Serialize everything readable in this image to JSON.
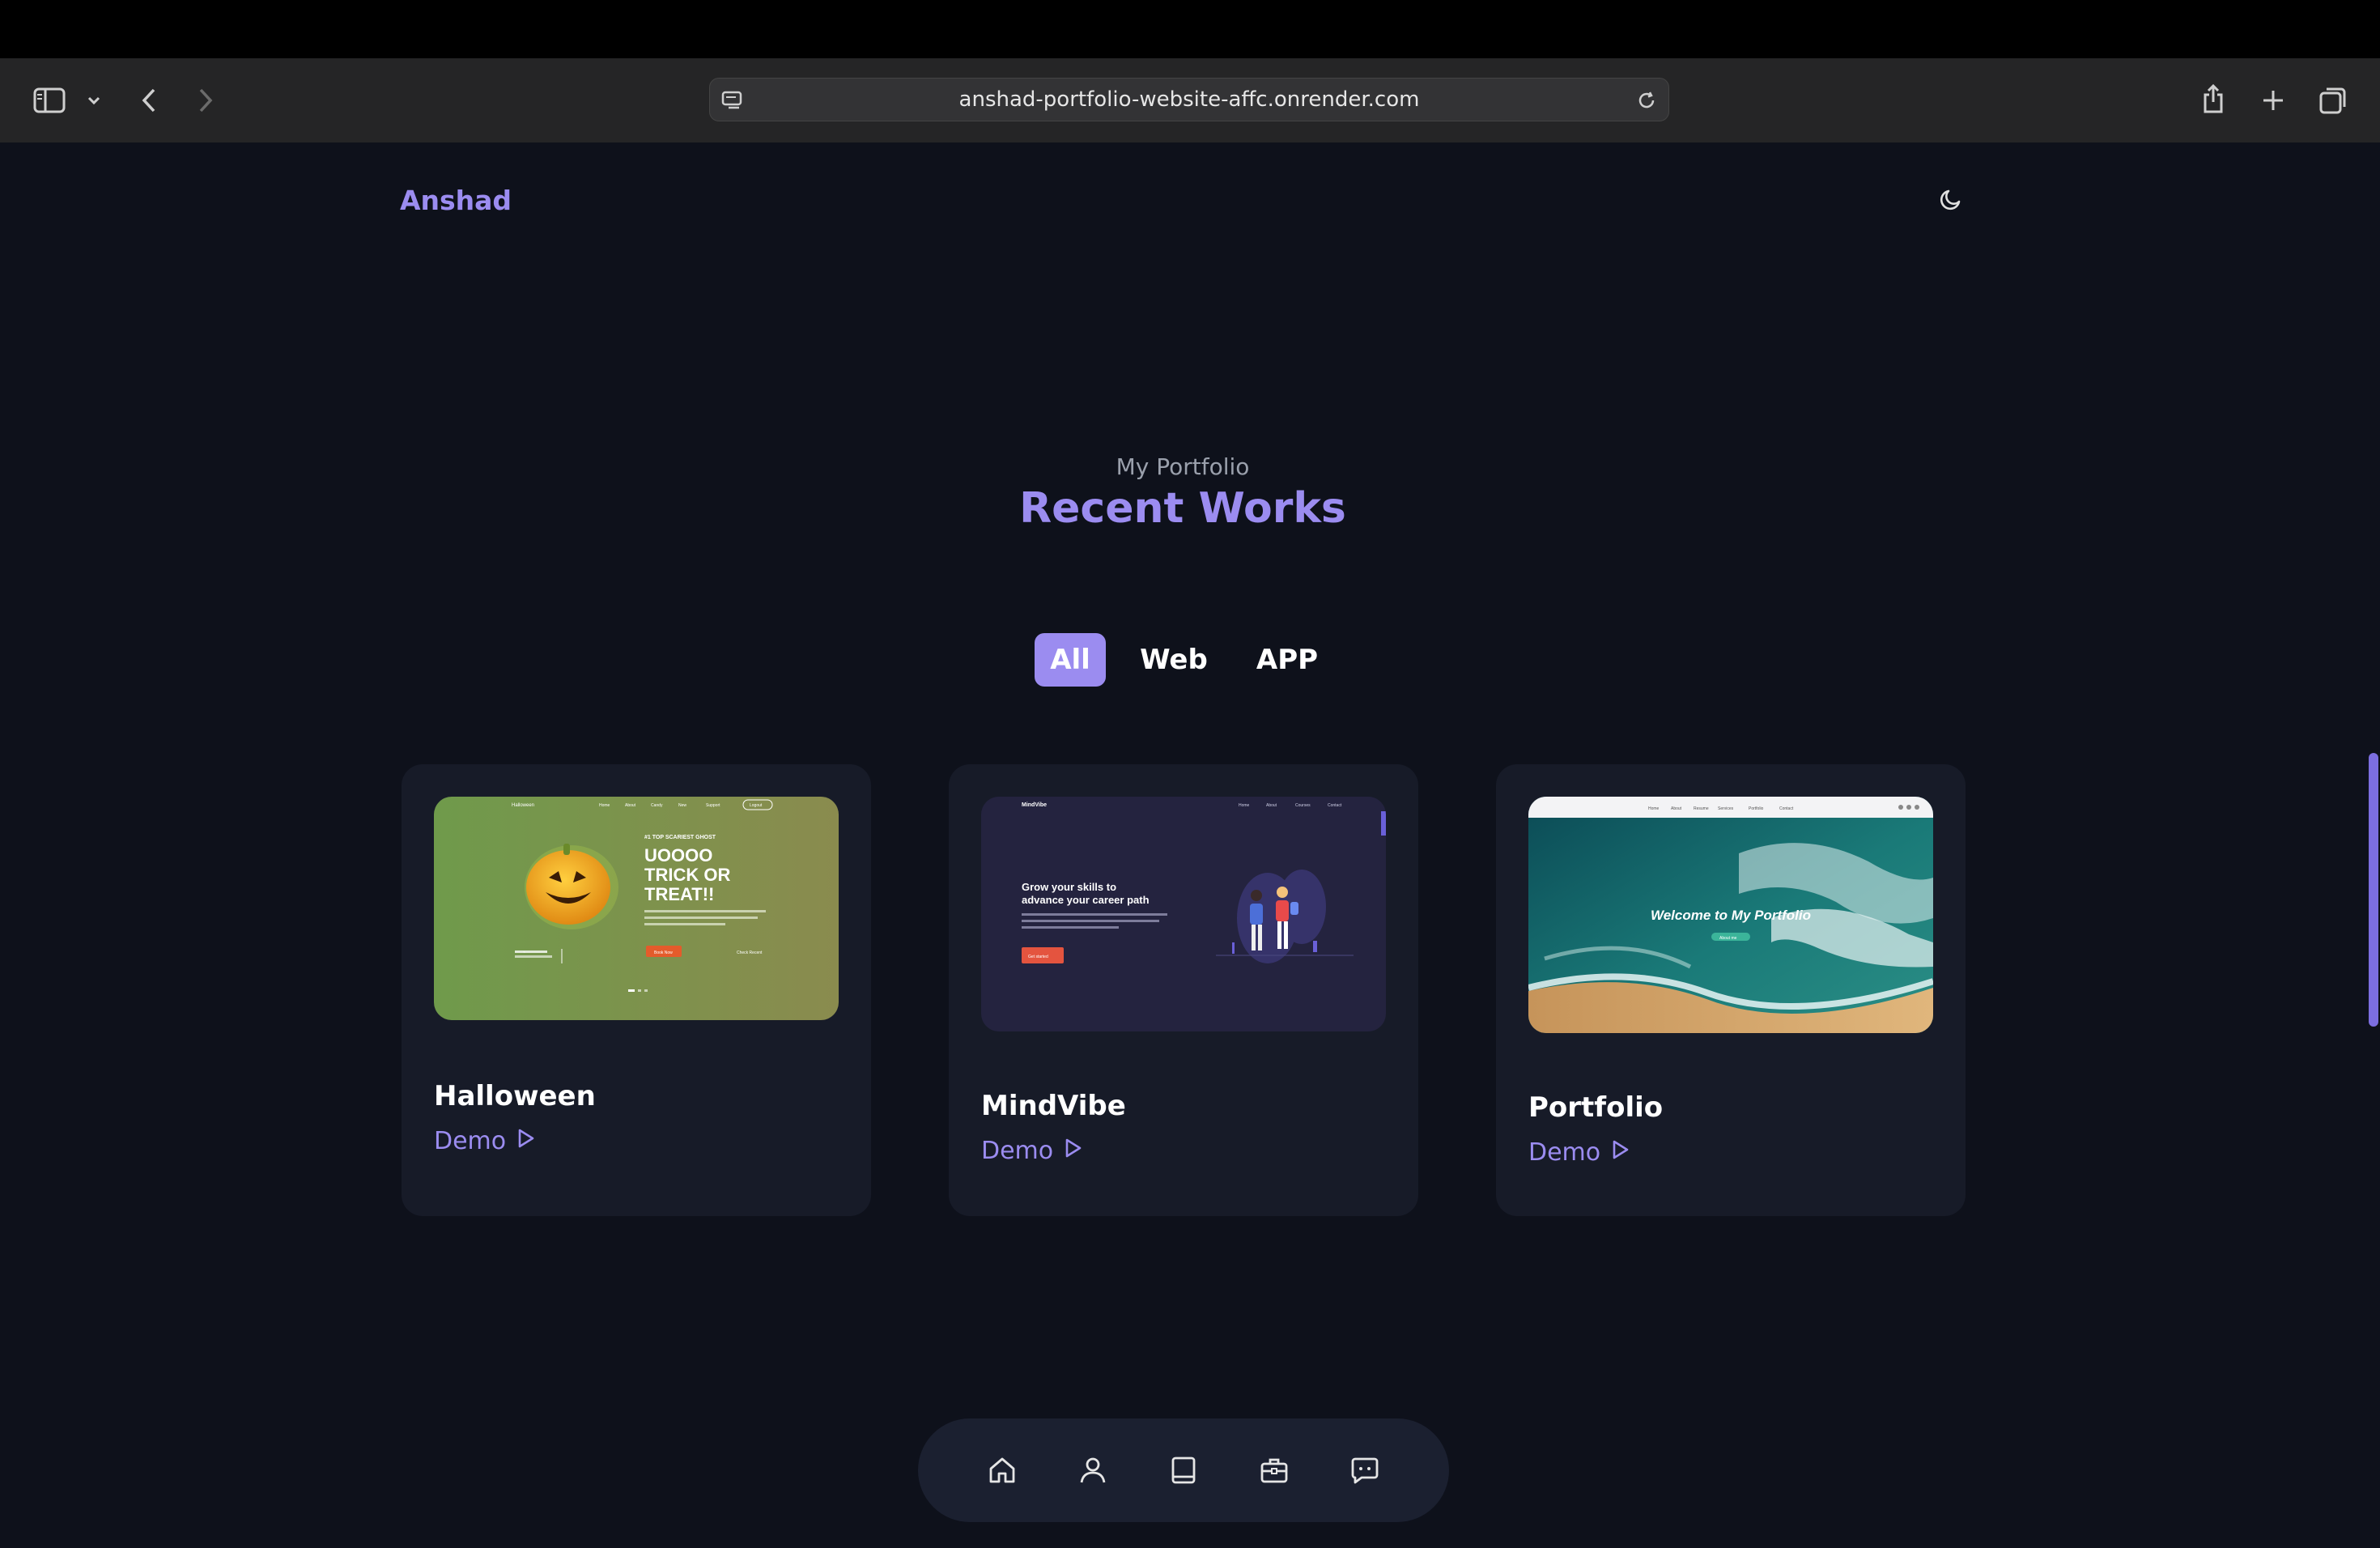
{
  "browser": {
    "url": "anshad-portfolio-website-affc.onrender.com",
    "icons": [
      "sidebar-icon",
      "chevron-down-icon",
      "back-icon",
      "forward-icon",
      "site-settings-icon",
      "reload-icon",
      "share-icon",
      "new-tab-icon",
      "tab-overview-icon"
    ]
  },
  "header": {
    "brand": "Anshad",
    "theme_icon": "moon-icon"
  },
  "section": {
    "subtitle": "My Portfolio",
    "title": "Recent Works"
  },
  "filters": [
    {
      "label": "All",
      "active": true
    },
    {
      "label": "Web",
      "active": false
    },
    {
      "label": "APP",
      "active": false
    }
  ],
  "projects": [
    {
      "title": "Halloween",
      "link": "Demo",
      "preview": {
        "brand": "Halloween",
        "nav": [
          "Home",
          "About",
          "Candy",
          "New",
          "Support",
          "Logout"
        ],
        "eyebrow": "#1 TOP SCARIEST GHOST",
        "headline": "UOOOO TRICK OR TREAT!!",
        "cta": "Book Now",
        "side_link": "Check Recent"
      }
    },
    {
      "title": "MindVibe",
      "link": "Demo",
      "preview": {
        "brand": "MindVibe",
        "nav": [
          "Home",
          "About",
          "Courses",
          "Contact"
        ],
        "headline": "Grow your skills to advance your career path",
        "cta": "Get started"
      }
    },
    {
      "title": "Portfolio",
      "link": "Demo",
      "preview": {
        "nav": [
          "Home",
          "About",
          "Resume",
          "Services",
          "Portfolio",
          "Contact"
        ],
        "headline": "Welcome to My Portfolio",
        "cta": "About me"
      }
    }
  ],
  "bottom_nav": [
    "home-icon",
    "user-icon",
    "book-icon",
    "briefcase-icon",
    "message-icon"
  ],
  "colors": {
    "accent": "#9b8cf0",
    "background": "#0e111b",
    "card": "#171b28"
  }
}
